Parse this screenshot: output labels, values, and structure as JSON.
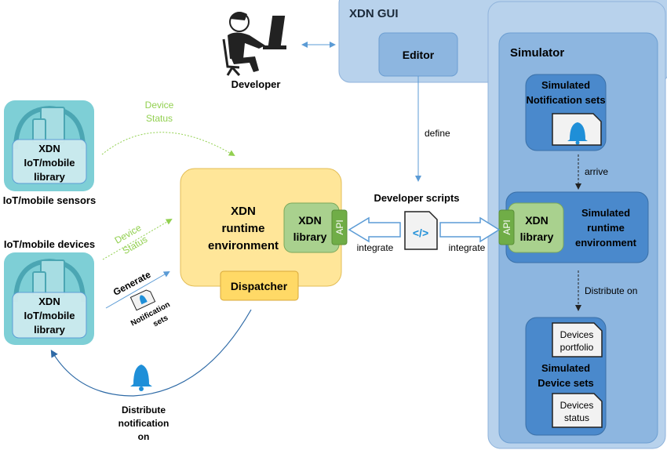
{
  "colors": {
    "gui_bg": "#b8d2ec",
    "inner_bg": "#8db6e0",
    "dark_blue": "#4a89cc",
    "yellow": "#ffe699",
    "dispatcher": "#ffd966",
    "green_lib": "#a9d18e",
    "api_green": "#70ad47",
    "teal": "#7ecfd6",
    "status_green": "#92d050",
    "arrow_blue": "#5b9bd5"
  },
  "gui": {
    "title": "XDN GUI",
    "editor": "Editor"
  },
  "developer": {
    "label": "Developer",
    "icon": "developer-at-computer-icon"
  },
  "define": "define",
  "simulator": {
    "title": "Simulator",
    "notif_sets": [
      "Simulated",
      "Notification sets"
    ],
    "arrive": "arrive",
    "runtime": [
      "Simulated",
      "runtime",
      "environment"
    ],
    "library": [
      "XDN",
      "library"
    ],
    "api": "API",
    "distribute": "Distribute on",
    "device_sets": [
      "Simulated",
      "Device sets"
    ],
    "portfolio": [
      "Devices",
      "portfolio"
    ],
    "status": [
      "Devices",
      "status"
    ]
  },
  "scripts": {
    "label": "Developer scripts",
    "icon": "code-file-icon",
    "integrate_left": "integrate",
    "integrate_right": "integrate"
  },
  "runtime": {
    "title": [
      "XDN",
      "runtime",
      "environment"
    ],
    "library": [
      "XDN",
      "library"
    ],
    "api": "API",
    "dispatcher": "Dispatcher"
  },
  "sensors": {
    "tile": [
      "XDN",
      "IoT/mobile",
      "library"
    ],
    "label": "IoT/mobile sensors",
    "status": [
      "Device",
      "Status"
    ]
  },
  "devices": {
    "tile": [
      "XDN",
      "IoT/mobile",
      "library"
    ],
    "label": "IoT/mobile devices",
    "status": [
      "Device",
      "Status"
    ],
    "generate": "Generate",
    "notif": [
      "Notification",
      "sets"
    ]
  },
  "distribute": [
    "Distribute",
    "notification",
    "on"
  ]
}
